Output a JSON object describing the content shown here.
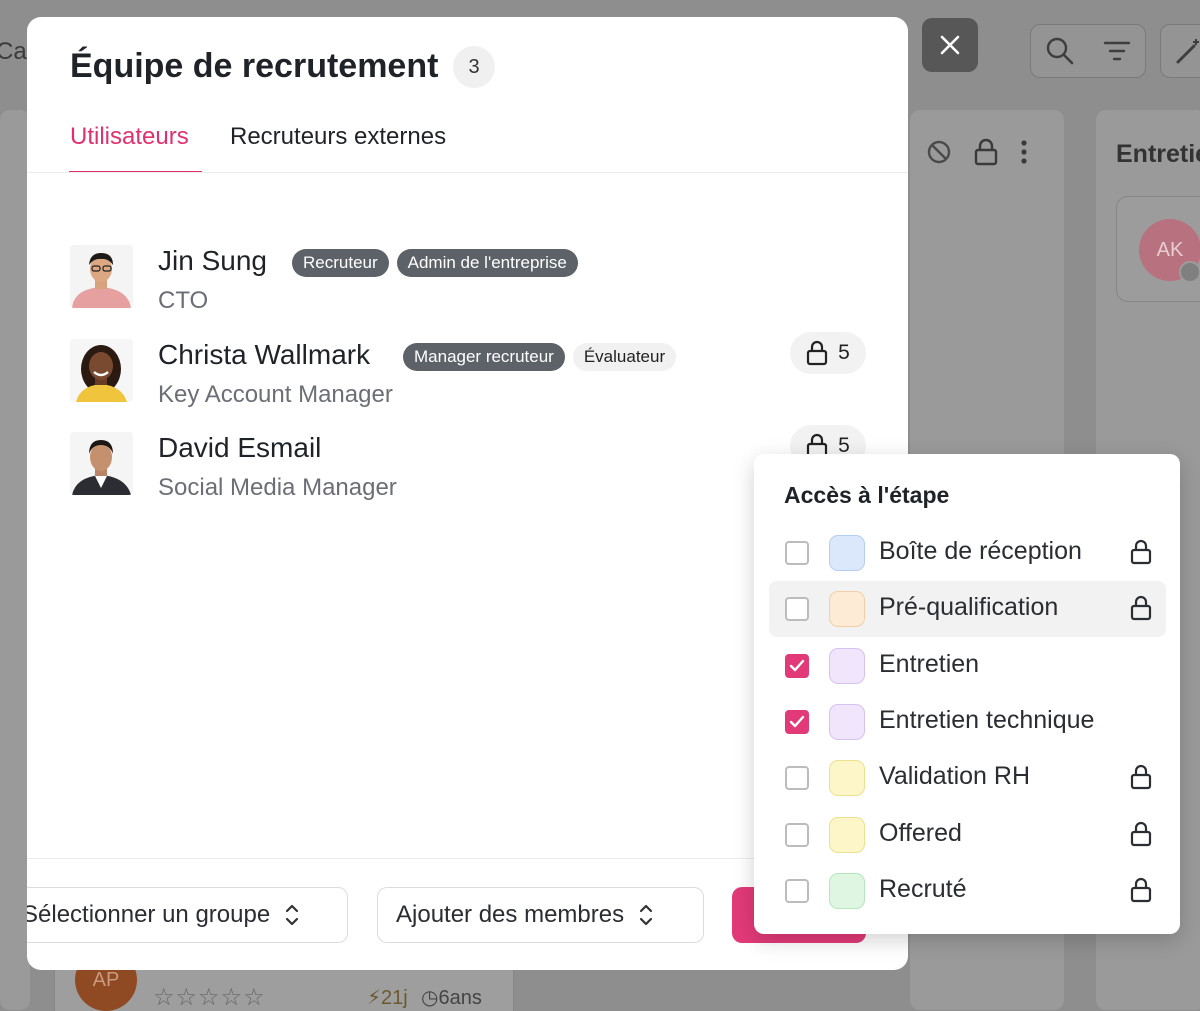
{
  "background": {
    "left_text": "Cal",
    "column_heading": "Entretie",
    "card_avatar_initials": "AK",
    "bottom_card": {
      "avatar_initials": "AP",
      "stars": "☆☆☆☆☆",
      "days": "21j",
      "age": "6ans"
    }
  },
  "modal": {
    "title": "Équipe de recrutement",
    "member_count": "3",
    "tabs": [
      {
        "label": "Utilisateurs",
        "active": true
      },
      {
        "label": "Recruteurs externes",
        "active": false
      }
    ],
    "members": [
      {
        "name": "Jin Sung",
        "role": "CTO",
        "tags": [
          "Recruteur",
          "Admin de l'entreprise"
        ],
        "locks": null
      },
      {
        "name": "Christa Wallmark",
        "role": "Key Account Manager",
        "tags": [
          "Manager recruteur",
          "Évaluateur"
        ],
        "locks": "5"
      },
      {
        "name": "David Esmail",
        "role": "Social Media Manager",
        "tags": [],
        "locks": "5"
      }
    ],
    "footer": {
      "group_select": "Sélectionner un groupe",
      "members_select": "Ajouter des membres"
    }
  },
  "stage_access": {
    "title": "Accès à l'étape",
    "stages": [
      {
        "label": "Boîte de réception",
        "checked": false,
        "locked": true,
        "color": "#dbe8fb",
        "border": "#b6cdf2"
      },
      {
        "label": "Pré-qualification",
        "checked": false,
        "locked": true,
        "color": "#fdebd6",
        "border": "#f3cfa6"
      },
      {
        "label": "Entretien",
        "checked": true,
        "locked": false,
        "color": "#f1e5fb",
        "border": "#d8c0f1"
      },
      {
        "label": "Entretien technique",
        "checked": true,
        "locked": false,
        "color": "#f1e5fb",
        "border": "#d8c0f1"
      },
      {
        "label": "Validation RH",
        "checked": false,
        "locked": true,
        "color": "#fcf6c8",
        "border": "#ece190"
      },
      {
        "label": "Offered",
        "checked": false,
        "locked": true,
        "color": "#fcf6c8",
        "border": "#ece190"
      },
      {
        "label": "Recruté",
        "checked": false,
        "locked": true,
        "color": "#dff6e2",
        "border": "#b5e6bd"
      }
    ]
  },
  "colors": {
    "accent": "#e23a78"
  }
}
